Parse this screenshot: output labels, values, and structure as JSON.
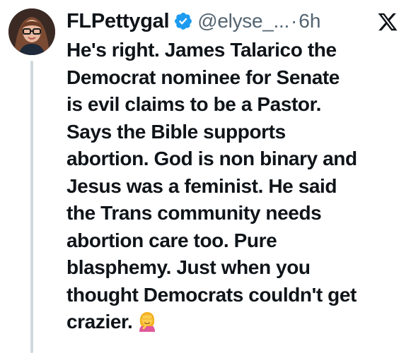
{
  "tweet": {
    "display_name": "FLPettygal",
    "handle": "@elyse_...",
    "separator": "·",
    "time": "6h",
    "verified_icon": "verified-badge-icon",
    "platform_icon": "x-logo-icon",
    "verified_color": "#1d9bf0",
    "lines": [
      "He's right. James Talarico the",
      "Democrat nominee for Senate",
      "is evil claims to be a Pastor.",
      "Says the Bible supports",
      "abortion. God is non binary and",
      "Jesus was a feminist.  He said",
      "the Trans community needs",
      "abortion care too. Pure",
      "blasphemy.  Just when you",
      "thought Democrats couldn't get",
      "crazier."
    ],
    "end_emoji": "woman-facepalming-emoji"
  }
}
